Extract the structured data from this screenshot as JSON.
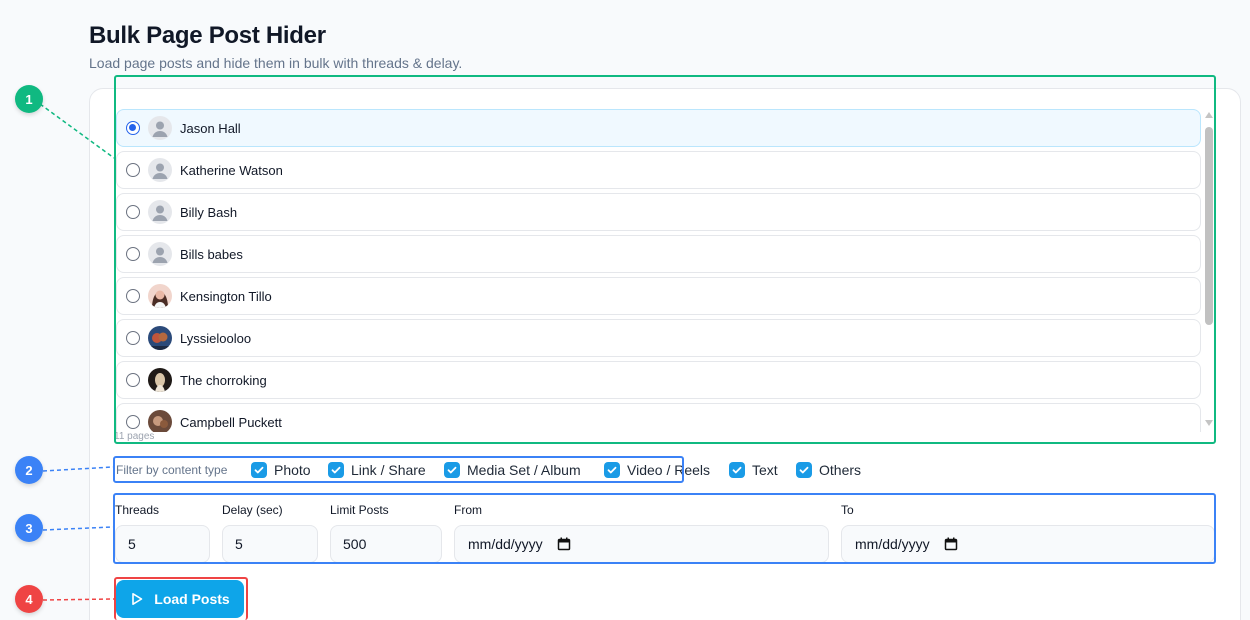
{
  "header": {
    "title": "Bulk Page Post Hider",
    "subtitle": "Load page posts and hide them in bulk with threads & delay."
  },
  "badges": [
    "1",
    "2",
    "3",
    "4"
  ],
  "pages": {
    "items": [
      {
        "name": "Jason Hall",
        "selected": true,
        "avatar": "default-avatar"
      },
      {
        "name": "Katherine Watson",
        "selected": false,
        "avatar": "default-avatar"
      },
      {
        "name": "Billy Bash",
        "selected": false,
        "avatar": "default-avatar"
      },
      {
        "name": "Bills babes",
        "selected": false,
        "avatar": "default-avatar"
      },
      {
        "name": "Kensington Tillo",
        "selected": false,
        "avatar": "photo-avatar"
      },
      {
        "name": "Lyssielooloo",
        "selected": false,
        "avatar": "photo-avatar"
      },
      {
        "name": "The chorroking",
        "selected": false,
        "avatar": "photo-avatar"
      },
      {
        "name": "Campbell Puckett",
        "selected": false,
        "avatar": "photo-avatar"
      }
    ],
    "count_label": "11 pages"
  },
  "filter": {
    "label": "Filter by content type",
    "options": [
      {
        "label": "Photo",
        "checked": true
      },
      {
        "label": "Link / Share",
        "checked": true
      },
      {
        "label": "Media Set / Album",
        "checked": true
      },
      {
        "label": "Video / Reels",
        "checked": true
      },
      {
        "label": "Text",
        "checked": true
      },
      {
        "label": "Others",
        "checked": true
      }
    ]
  },
  "settings": {
    "threads": {
      "label": "Threads",
      "value": "5"
    },
    "delay": {
      "label": "Delay (sec)",
      "value": "5"
    },
    "limit": {
      "label": "Limit Posts",
      "value": "500"
    },
    "from": {
      "label": "From",
      "placeholder": "mm/dd/yyyy"
    },
    "to": {
      "label": "To",
      "placeholder": "mm/dd/yyyy"
    }
  },
  "actions": {
    "load_label": "Load Posts"
  },
  "colors": {
    "accent": "#0ea5e9",
    "checkbox": "#1a9be6",
    "annotation_green": "#10b981",
    "annotation_blue": "#3b82f6",
    "annotation_red": "#ef4444"
  }
}
